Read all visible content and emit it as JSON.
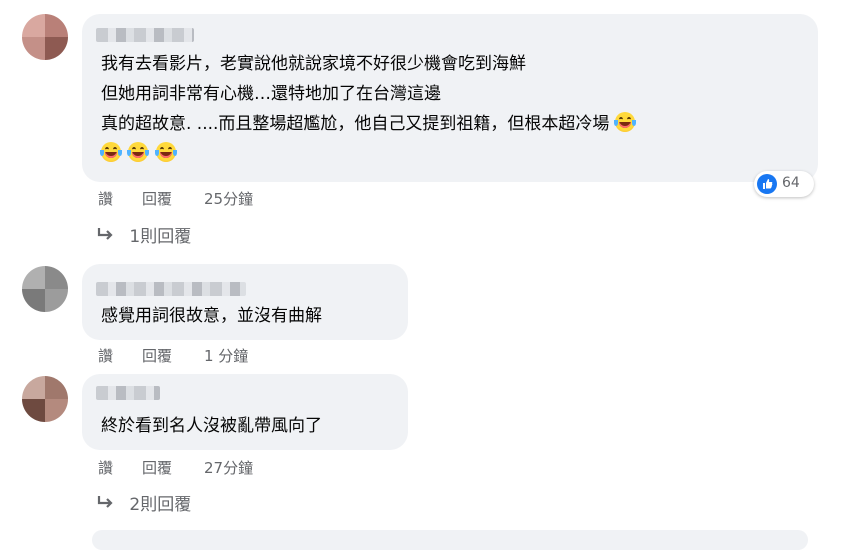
{
  "comments": [
    {
      "lines": [
        "我有去看影片，老實說他就說家境不好很少機會吃到海鮮",
        "但她用詞非常有心機…還特地加了在台灣這邊",
        "真的超故意. ....而且整場超尷尬，他自己又提到祖籍，但根本超冷場"
      ],
      "emoji_count_inline": 1,
      "emoji_row_count": 3,
      "reaction": {
        "icon": "like-icon",
        "count": "64"
      },
      "actions": {
        "like": "讚",
        "reply": "回覆",
        "time": "25分鐘"
      },
      "replies_label": "1則回覆"
    },
    {
      "lines": [
        "感覺用詞很故意，並沒有曲解"
      ],
      "actions": {
        "like": "讚",
        "reply": "回覆",
        "time": "1 分鐘"
      }
    },
    {
      "lines": [
        "終於看到名人沒被亂帶風向了"
      ],
      "actions": {
        "like": "讚",
        "reply": "回覆",
        "time": "27分鐘"
      },
      "replies_label": "2則回覆"
    }
  ],
  "colors": {
    "bubble": "#f0f2f5",
    "secondary_text": "#65676b",
    "like_blue": "#1877f2",
    "emoji_yellow": "#ffd93b"
  }
}
